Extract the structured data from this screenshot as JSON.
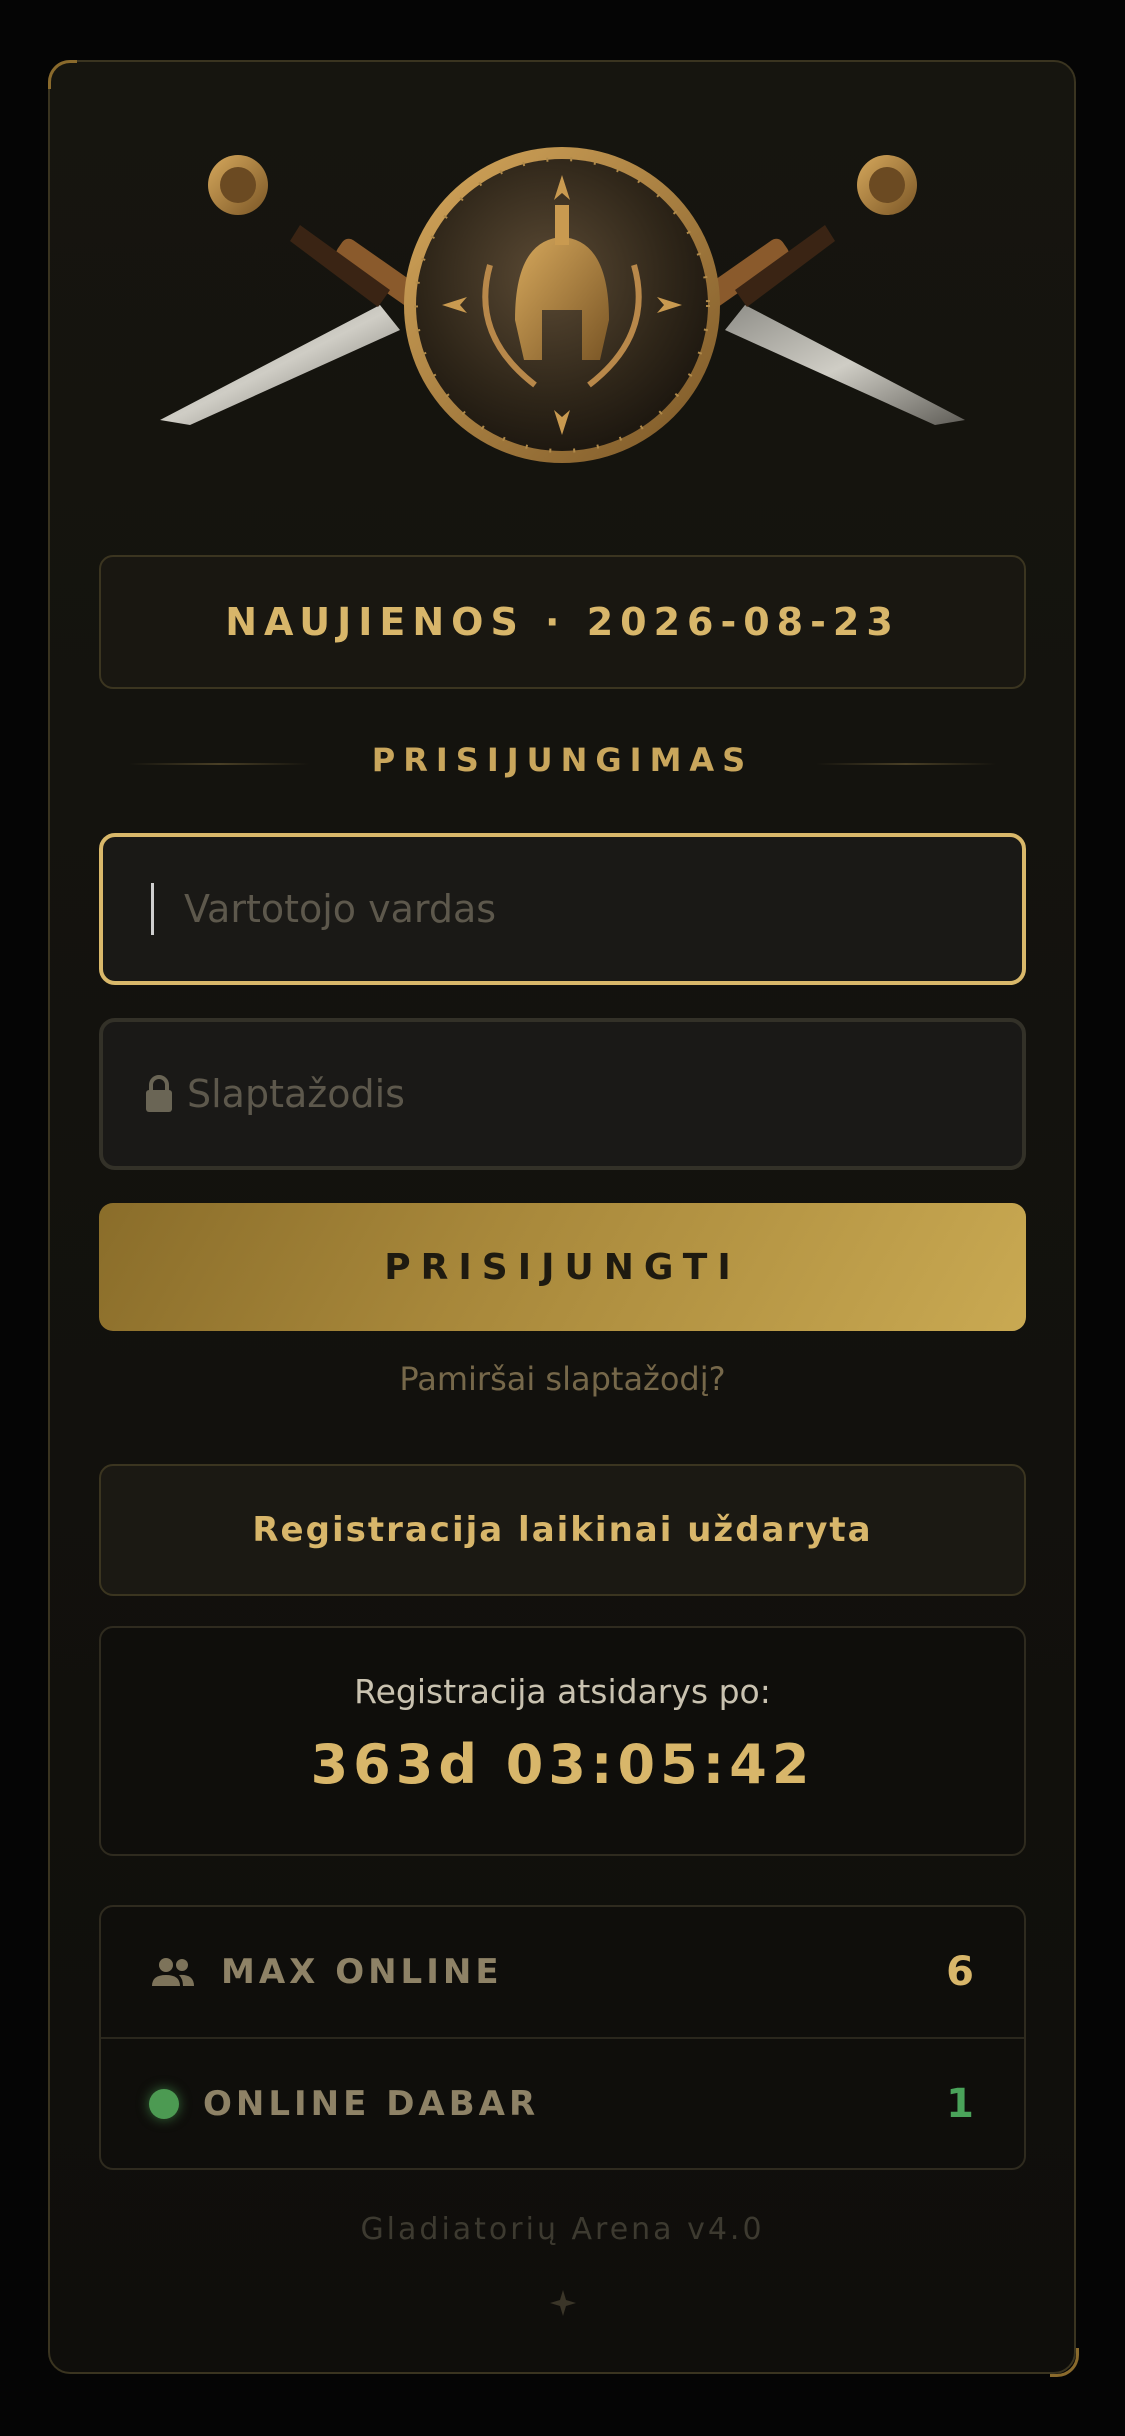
{
  "news": {
    "label": "NAUJIENOS · 2026-08-23"
  },
  "login": {
    "section_title": "PRISIJUNGIMAS",
    "username_placeholder": "Vartotojo vardas",
    "password_placeholder": "Slaptažodis",
    "submit_label": "PRISIJUNGTI",
    "forgot_link": "Pamiršai slaptažodį?"
  },
  "registration": {
    "status": "Registracija laikinai uždaryta",
    "countdown_label": "Registracija atsidarys po:",
    "countdown_value": "363d 03:05:42"
  },
  "stats": {
    "max_online_label": "MAX ONLINE",
    "max_online_value": "6",
    "online_now_label": "ONLINE DABAR",
    "online_now_value": "1"
  },
  "footer": {
    "version": "Gladiatorių Arena v4.0"
  },
  "colors": {
    "accent_gold": "#d8b66a",
    "online_green": "#4aa35a",
    "background": "#050505"
  },
  "icons": {
    "emblem": "crossed-swords-shield-helmet-icon",
    "password": "lock-icon",
    "max_online": "users-icon",
    "online_now": "status-dot-icon",
    "footer": "sparkle-icon"
  }
}
